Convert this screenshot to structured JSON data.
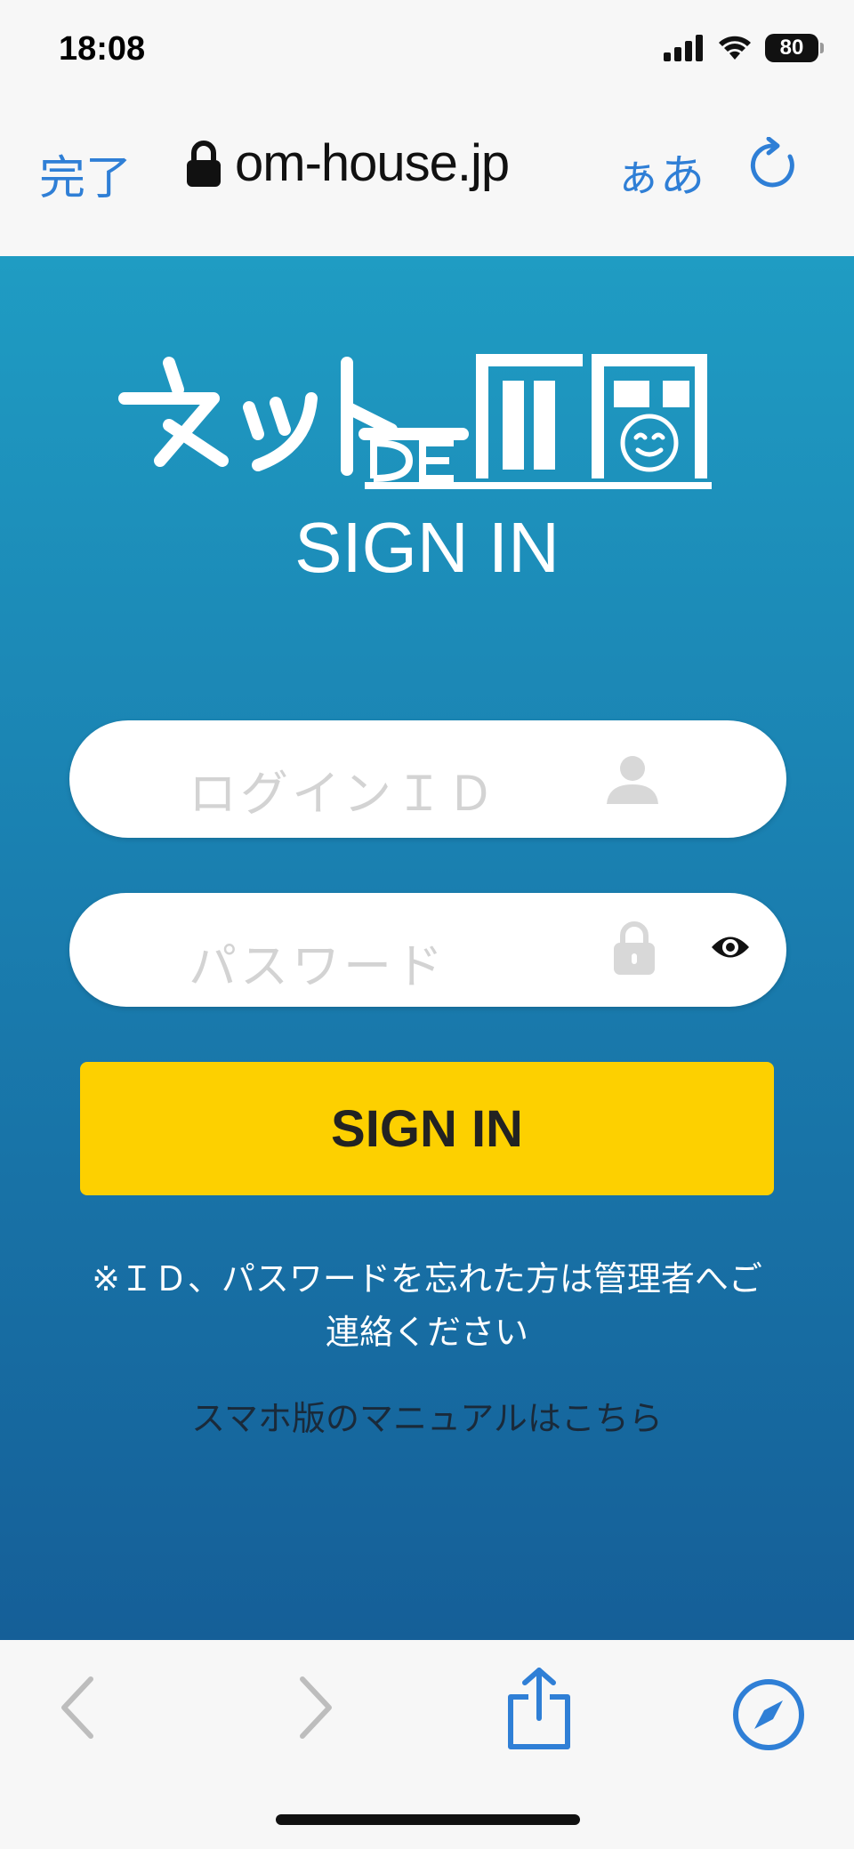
{
  "status_bar": {
    "time": "18:08",
    "battery": "80"
  },
  "address_bar": {
    "done_label": "完了",
    "url": "om-house.jp",
    "text_size_label": "ぁあ"
  },
  "login": {
    "title": "SIGN IN",
    "login_id_placeholder": "ログインＩＤ",
    "password_placeholder": "パスワード",
    "submit_label": "SIGN IN",
    "note": "※ＩＤ、パスワードを忘れた方は管理者へご連絡ください",
    "manual_link": "スマホ版のマニュアルはこちら"
  },
  "colors": {
    "accent_blue": "#2f7fd6",
    "gradient_top": "#1f9cc3",
    "gradient_bottom": "#155f98",
    "signin_yellow": "#fdd000"
  },
  "icons": [
    "lock-icon",
    "reload-icon",
    "user-icon",
    "password-lock-icon",
    "eye-icon",
    "back-icon",
    "forward-icon",
    "share-icon",
    "compass-icon"
  ]
}
